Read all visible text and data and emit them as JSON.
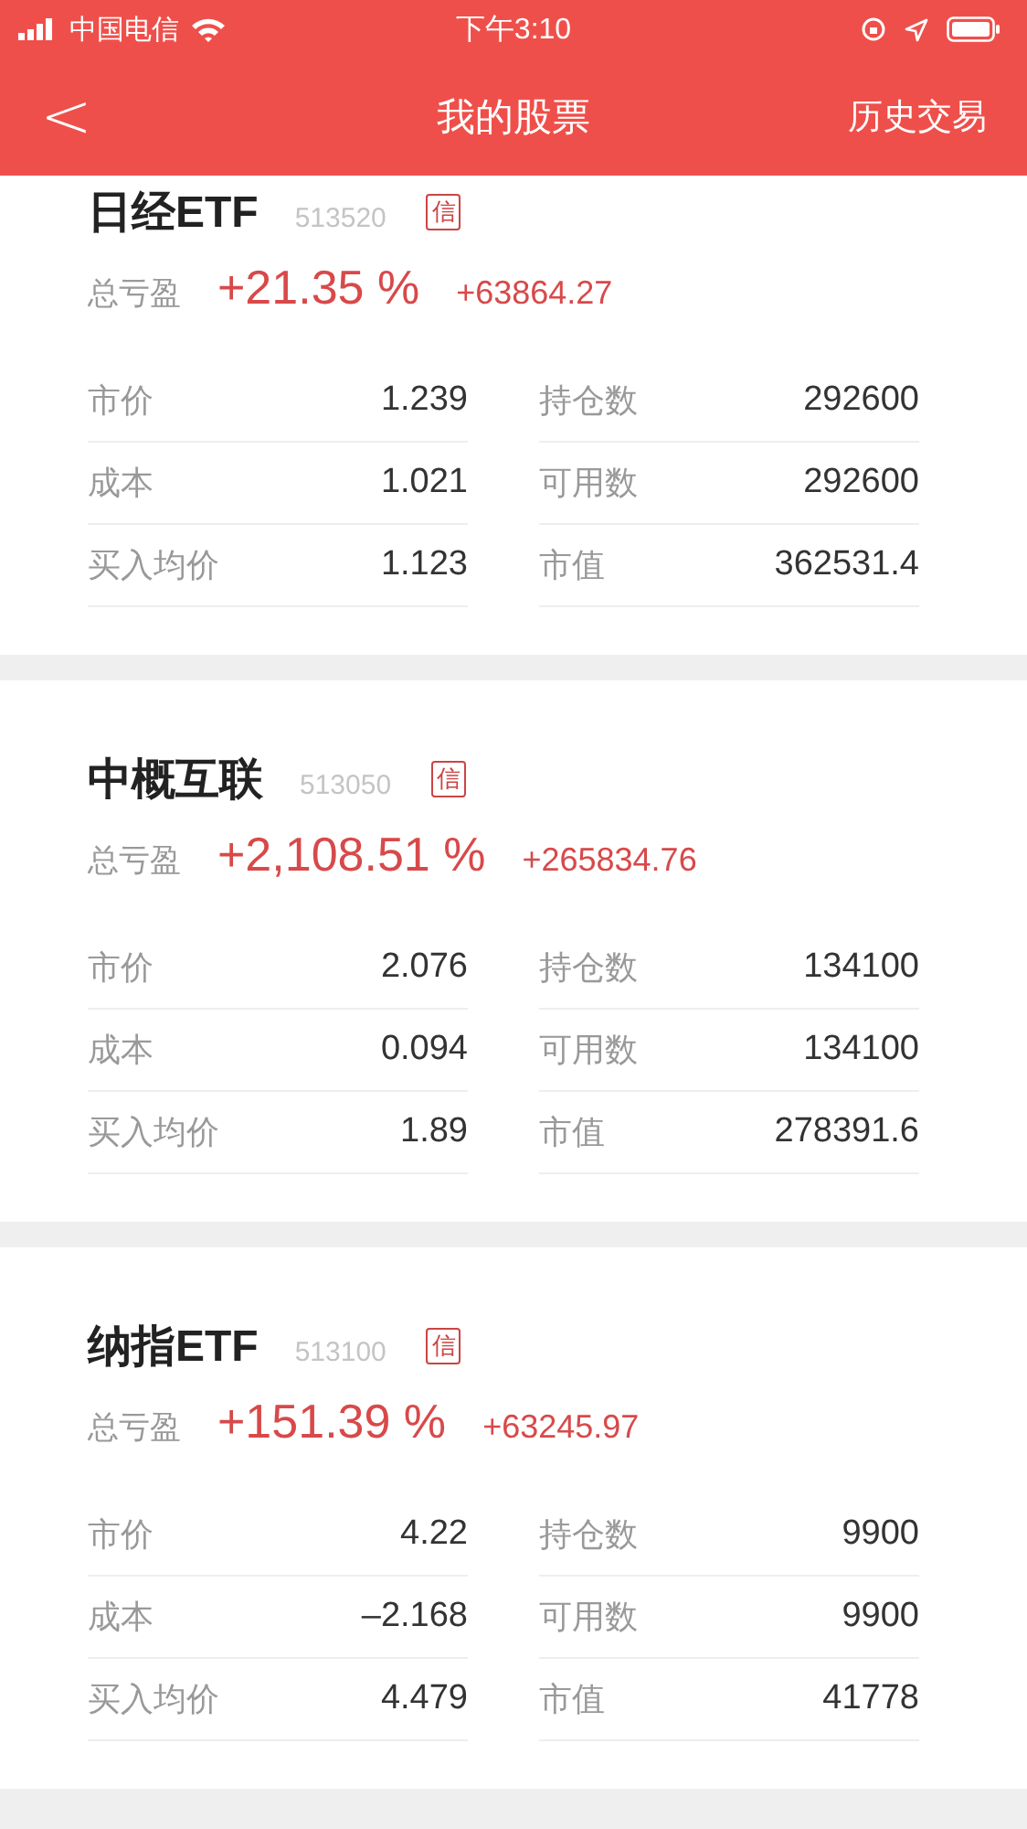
{
  "status_bar": {
    "carrier": "中国电信",
    "time": "下午3:10"
  },
  "nav": {
    "back": "<",
    "title": "我的股票",
    "action": "历史交易"
  },
  "cards": [
    {
      "name": "日经ETF",
      "code": "513520",
      "tag": "信",
      "profit_label": "总亏盈",
      "profit_pct": "+21.35 %",
      "profit_amount": "+63864.27",
      "stats": [
        {
          "label": "市价",
          "value": "1.239"
        },
        {
          "label": "持仓数",
          "value": "292600"
        },
        {
          "label": "成本",
          "value": "1.021"
        },
        {
          "label": "可用数",
          "value": "292600"
        },
        {
          "label": "买入均价",
          "value": "1.123"
        },
        {
          "label": "市值",
          "value": "362531.4"
        }
      ]
    },
    {
      "name": "中概互联",
      "code": "513050",
      "tag": "信",
      "profit_label": "总亏盈",
      "profit_pct": "+2,108.51 %",
      "profit_amount": "+265834.76",
      "stats": [
        {
          "label": "市价",
          "value": "2.076"
        },
        {
          "label": "持仓数",
          "value": "134100"
        },
        {
          "label": "成本",
          "value": "0.094"
        },
        {
          "label": "可用数",
          "value": "134100"
        },
        {
          "label": "买入均价",
          "value": "1.89"
        },
        {
          "label": "市值",
          "value": "278391.6"
        }
      ]
    },
    {
      "name": "纳指ETF",
      "code": "513100",
      "tag": "信",
      "profit_label": "总亏盈",
      "profit_pct": "+151.39 %",
      "profit_amount": "+63245.97",
      "stats": [
        {
          "label": "市价",
          "value": "4.22"
        },
        {
          "label": "持仓数",
          "value": "9900"
        },
        {
          "label": "成本",
          "value": "–2.168"
        },
        {
          "label": "可用数",
          "value": "9900"
        },
        {
          "label": "买入均价",
          "value": "4.479"
        },
        {
          "label": "市值",
          "value": "41778"
        }
      ]
    }
  ]
}
